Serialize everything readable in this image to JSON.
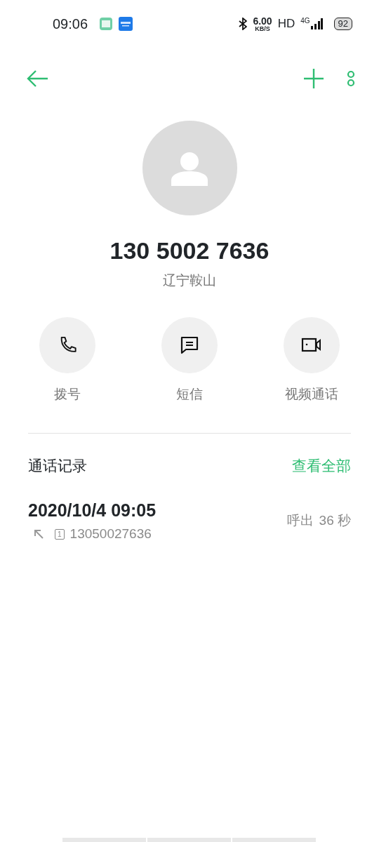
{
  "status_bar": {
    "time": "09:06",
    "speed_value": "6.00",
    "speed_unit": "KB/S",
    "hd": "HD",
    "network": "4G",
    "battery": "92"
  },
  "contact": {
    "number": "130 5002 7636",
    "location": "辽宁鞍山"
  },
  "actions": [
    {
      "kind": "phone",
      "label": "拨号"
    },
    {
      "kind": "message",
      "label": "短信"
    },
    {
      "kind": "video",
      "label": "视频通话"
    }
  ],
  "call_log": {
    "title": "通话记录",
    "view_all": "查看全部",
    "entries": [
      {
        "datetime": "2020/10/4 09:05",
        "sim_slot": "1",
        "number": "13050027636",
        "direction": "呼出",
        "duration": "36 秒"
      }
    ]
  }
}
